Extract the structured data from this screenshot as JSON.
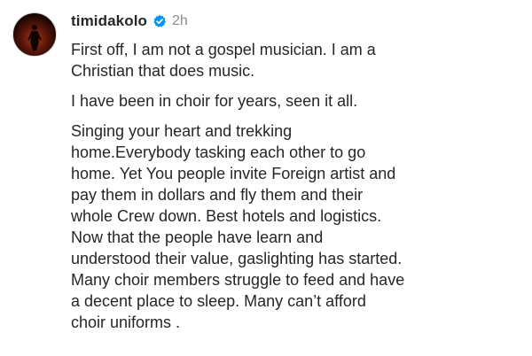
{
  "comment": {
    "username": "timidakolo",
    "verified_icon": "verified-badge-icon",
    "verified_color": "#0095f6",
    "time": "2h",
    "avatar_icon": "person-silhouette-avatar",
    "paragraphs": [
      "First off, I am not a gospel musician. I am a\nChristian that does music.",
      "I have been in choir for years, seen it all.",
      "Singing your heart and trekking\nhome.Everybody tasking each other to go\nhome. Yet You people invite Foreign artist and\npay them in dollars and fly them and their\nwhole Crew down. Best hotels and logistics.\nNow that the people have learn and\nunderstood their value, gaslighting has started.\nMany choir members struggle to feed and have\na decent place to sleep. Many can’t afford\nchoir uniforms ."
    ]
  }
}
